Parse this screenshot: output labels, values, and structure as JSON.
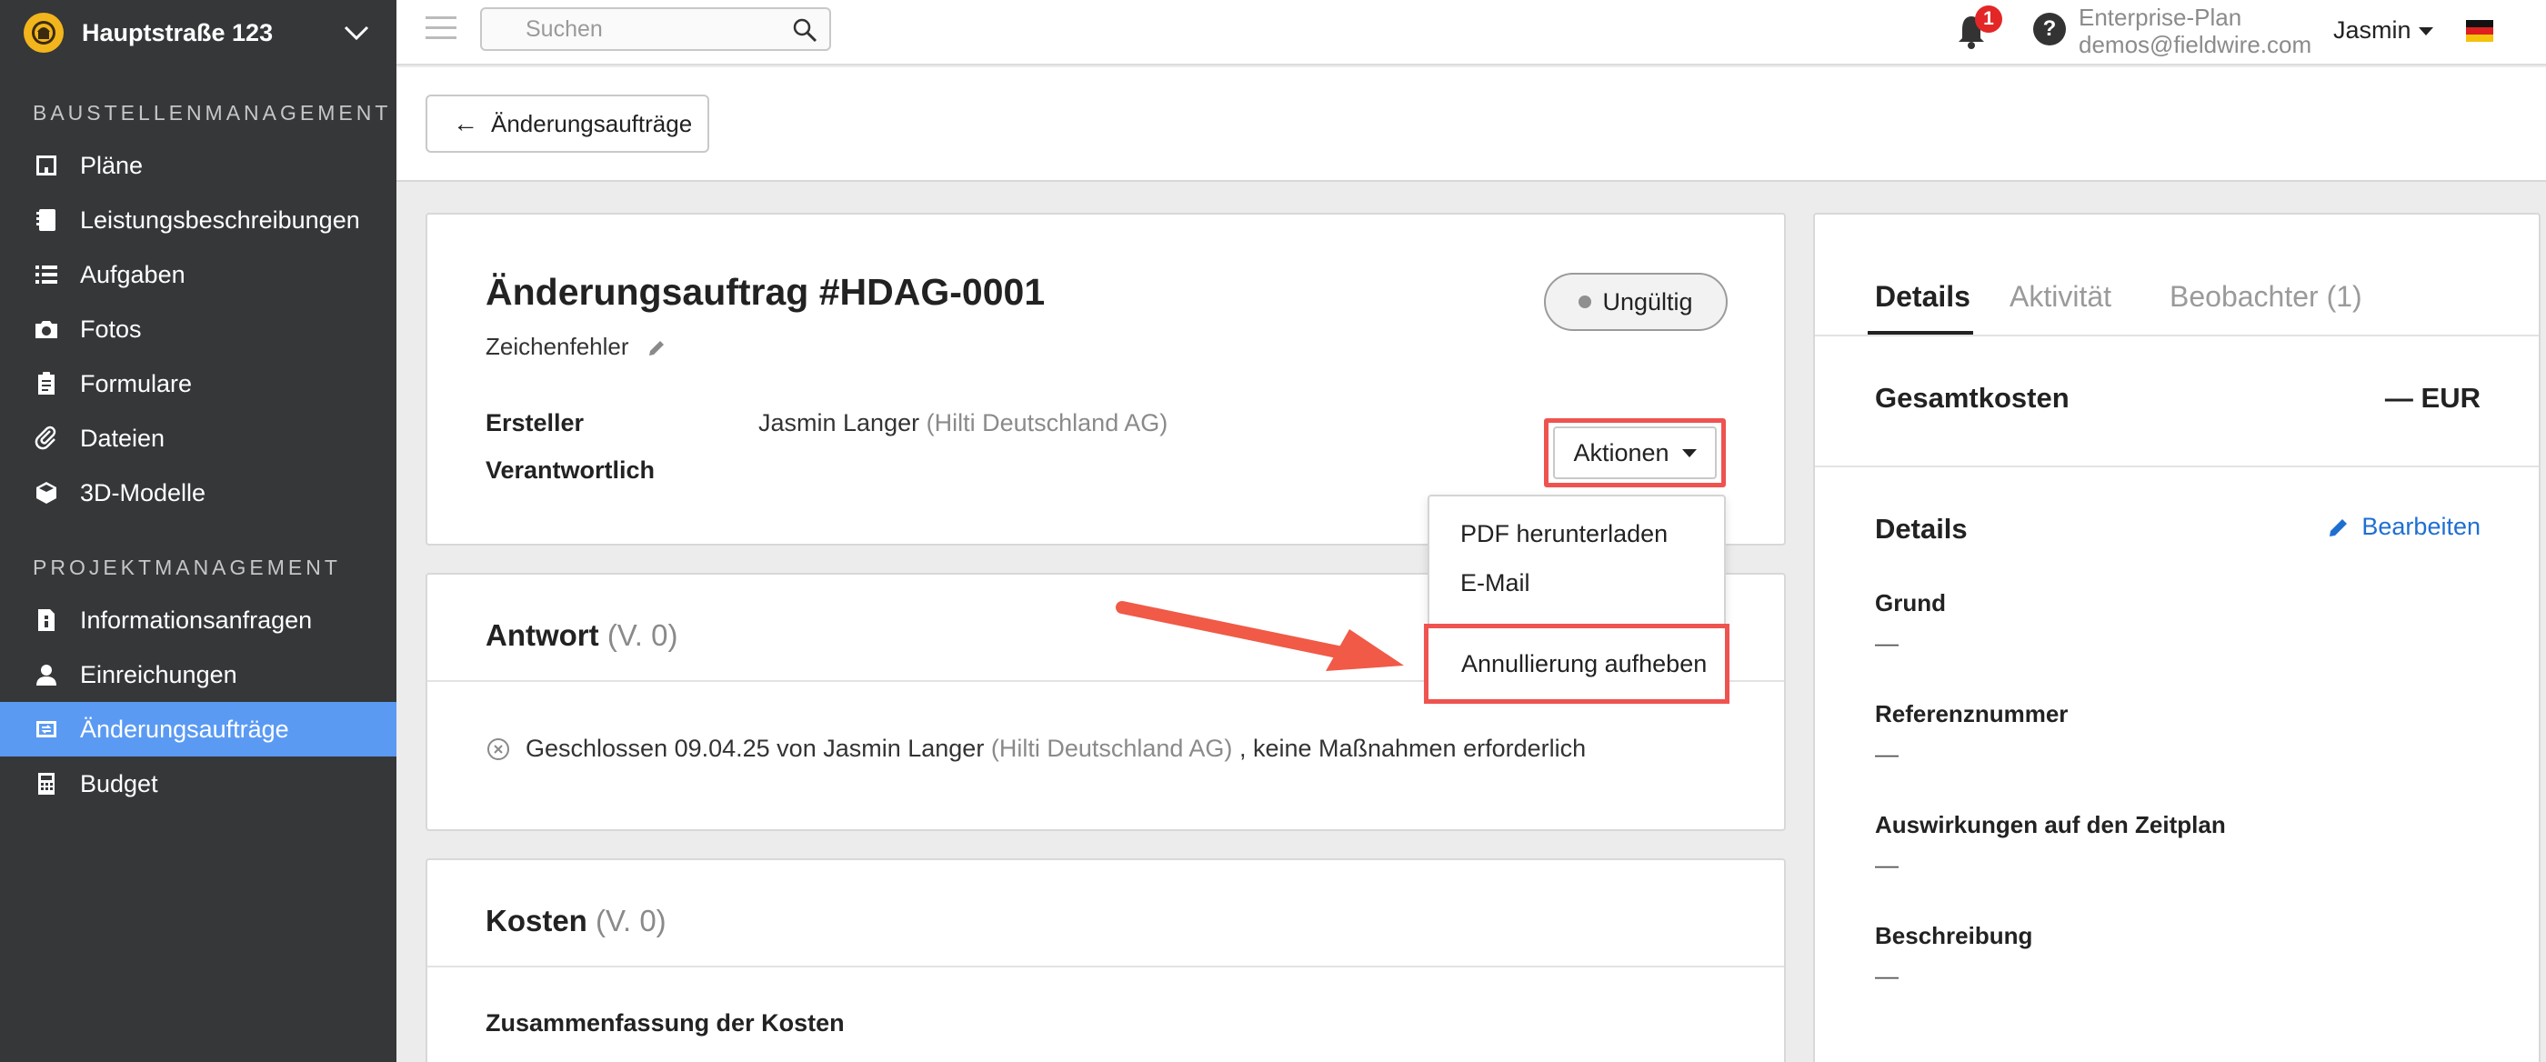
{
  "sidebar": {
    "project_name": "Hauptstraße 123",
    "section1": "BAUSTELLENMANAGEMENT",
    "section2": "PROJEKTMANAGEMENT",
    "items1": [
      {
        "label": "Pläne",
        "icon": "plans-icon"
      },
      {
        "label": "Leistungsbeschreibungen",
        "icon": "specs-icon"
      },
      {
        "label": "Aufgaben",
        "icon": "tasks-icon"
      },
      {
        "label": "Fotos",
        "icon": "camera-icon"
      },
      {
        "label": "Formulare",
        "icon": "forms-icon"
      },
      {
        "label": "Dateien",
        "icon": "paperclip-icon"
      },
      {
        "label": "3D-Modelle",
        "icon": "cube-icon"
      }
    ],
    "items2": [
      {
        "label": "Informationsanfragen",
        "icon": "rfi-icon"
      },
      {
        "label": "Einreichungen",
        "icon": "submittals-icon"
      },
      {
        "label": "Änderungsaufträge",
        "icon": "change-orders-icon",
        "active": true
      },
      {
        "label": "Budget",
        "icon": "calculator-icon"
      }
    ]
  },
  "topbar": {
    "search_placeholder": "Suchen",
    "notification_count": "1",
    "help": "?",
    "plan": "Enterprise-Plan",
    "email": "demos@fieldwire.com",
    "user": "Jasmin"
  },
  "subheader": {
    "back_label": "Änderungsaufträge"
  },
  "order": {
    "title": "Änderungsauftrag #HDAG-0001",
    "subtitle": "Zeichenfehler",
    "status": "Ungültig",
    "creator_label": "Ersteller",
    "creator_name": "Jasmin Langer",
    "creator_company": "(Hilti Deutschland AG)",
    "responsible_label": "Verantwortlich",
    "actions_label": "Aktionen"
  },
  "actions_menu": {
    "items": [
      "PDF herunterladen",
      "E-Mail",
      "Annullierung aufheben"
    ]
  },
  "response": {
    "title": "Antwort",
    "version": "(V. 0)",
    "closed_text": "Geschlossen 09.04.25 von Jasmin Langer",
    "closed_company": "(Hilti Deutschland AG)",
    "closed_suffix": ", keine Maßnahmen erforderlich"
  },
  "costs": {
    "title": "Kosten",
    "version": "(V. 0)",
    "summary_label": "Zusammenfassung der Kosten"
  },
  "right_panel": {
    "tabs": [
      "Details",
      "Aktivität",
      "Beobachter (1)"
    ],
    "total_label": "Gesamtkosten",
    "total_value": "— EUR",
    "details_title": "Details",
    "edit_label": "Bearbeiten",
    "fields": [
      {
        "label": "Grund",
        "value": "—"
      },
      {
        "label": "Referenznummer",
        "value": "—"
      },
      {
        "label": "Auswirkungen auf den Zeitplan",
        "value": "—"
      },
      {
        "label": "Beschreibung",
        "value": "—"
      }
    ]
  },
  "colors": {
    "sidebar_bg": "#363739",
    "active_nav": "#5a9af3",
    "highlight": "#ef5350",
    "link": "#1f6fd1"
  }
}
